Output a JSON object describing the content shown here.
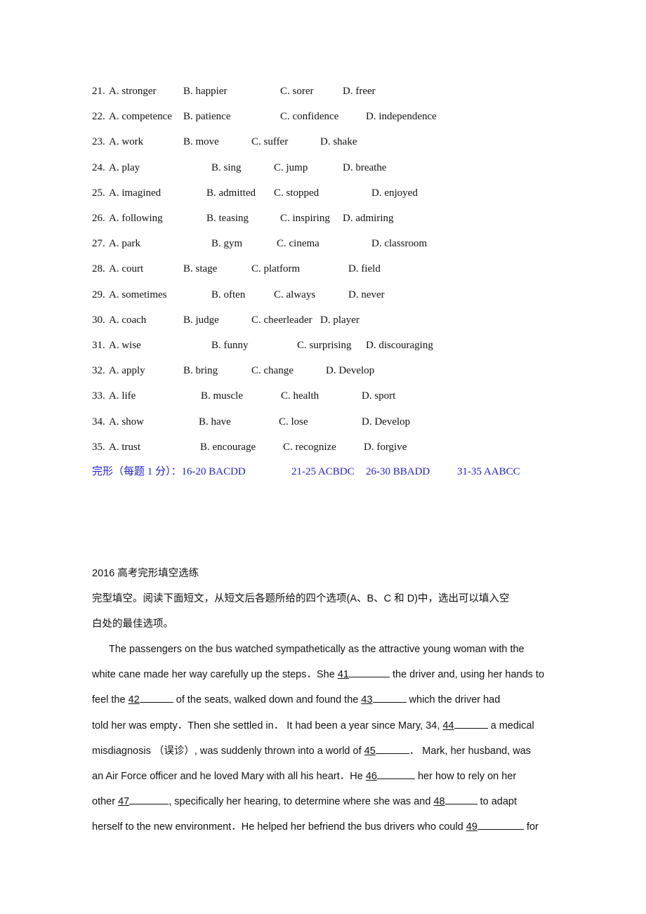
{
  "questions": [
    {
      "num": "21.",
      "a": "A. stronger",
      "b": "B. happier",
      "c": "C. sorer",
      "d": "D. freer"
    },
    {
      "num": "22.",
      "a": "A. competence",
      "b": "B. patience",
      "c": "C. confidence",
      "d": "D. independence"
    },
    {
      "num": "23.",
      "a": "A. work",
      "b": "B. move",
      "c": "C. suffer",
      "d": "D. shake"
    },
    {
      "num": "24.",
      "a": "A. play",
      "b": "B. sing",
      "c": "C. jump",
      "d": "D. breathe"
    },
    {
      "num": "25.",
      "a": "A. imagined",
      "b": "B. admitted",
      "c": "C. stopped",
      "d": "D. enjoyed"
    },
    {
      "num": "26.",
      "a": "A. following",
      "b": "B. teasing",
      "c": "C. inspiring",
      "d": "D. admiring"
    },
    {
      "num": "27.",
      "a": "A. park",
      "b": "B. gym",
      "c": "C. cinema",
      "d": "D. classroom"
    },
    {
      "num": "28.",
      "a": "A. court",
      "b": "B. stage",
      "c": "C. platform",
      "d": "D. field"
    },
    {
      "num": "29.",
      "a": "A. sometimes",
      "b": "B. often",
      "c": "C. always",
      "d": "D. never"
    },
    {
      "num": "30.",
      "a": "A. coach",
      "b": "B. judge",
      "c": "C. cheerleader",
      "d": "D. player"
    },
    {
      "num": "31.",
      "a": "A. wise",
      "b": "B. funny",
      "c": "C. surprising",
      "d": "D. discouraging"
    },
    {
      "num": "32.",
      "a": "A. apply",
      "b": "B. bring",
      "c": "C. change",
      "d": "D. Develop"
    },
    {
      "num": "33.",
      "a": "A. life",
      "b": "B. muscle",
      "c": "C. health",
      "d": "D. sport"
    },
    {
      "num": "34.",
      "a": "A. show",
      "b": "B. have",
      "c": "C. lose",
      "d": "D. Develop"
    },
    {
      "num": "35.",
      "a": "A. trust",
      "b": "B. encourage",
      "c": "C. recognize",
      "d": "D. forgive"
    }
  ],
  "answers": {
    "label": "完形（每题 1 分）：16-20 BACDD",
    "group2": "21-25 ACBDC",
    "group3": "26-30 BBADD",
    "group4": "31-35 AABCC",
    "color": "#1f1fd6"
  },
  "section": {
    "title": "2016 高考完形填空选练",
    "instruction_line1": "完型填空。阅读下面短文，从短文后各题所给的四个选项(A、B、C 和 D)中，选出可以填入空",
    "instruction_line2": "白处的最佳选项。"
  },
  "passage": {
    "l1": "The passengers on the bus watched sympathetically as the attractive young woman with the",
    "l2a": "white cane made her way carefully up the steps．She ",
    "b41": "41",
    "l2b": " the driver and, using her hands to",
    "l3a": "feel the ",
    "b42": "42",
    "l3b": " of the seats, walked down and found the ",
    "b43": "43",
    "l3c": " which the driver had",
    "l4a": "told her was empty．Then she settled in．  It had been a year since Mary, 34, ",
    "b44": "44",
    "l4b": " a medical",
    "l5a": "misdiagnosis （误诊）, was suddenly thrown into a world of ",
    "b45": "45",
    "l5b": "．  Mark, her husband, was",
    "l6a": "an Air Force officer and he loved Mary with all his heart．He ",
    "b46": "46",
    "l6b": " her how to rely on her",
    "l7a": "other ",
    "b47": "47",
    "l7b": ", specifically her hearing, to determine where she was and ",
    "b48": "48",
    "l7c": " to adapt",
    "l8a": "herself to the new environment．He helped her befriend the bus drivers who could ",
    "b49": "49",
    "l8b": " for"
  }
}
